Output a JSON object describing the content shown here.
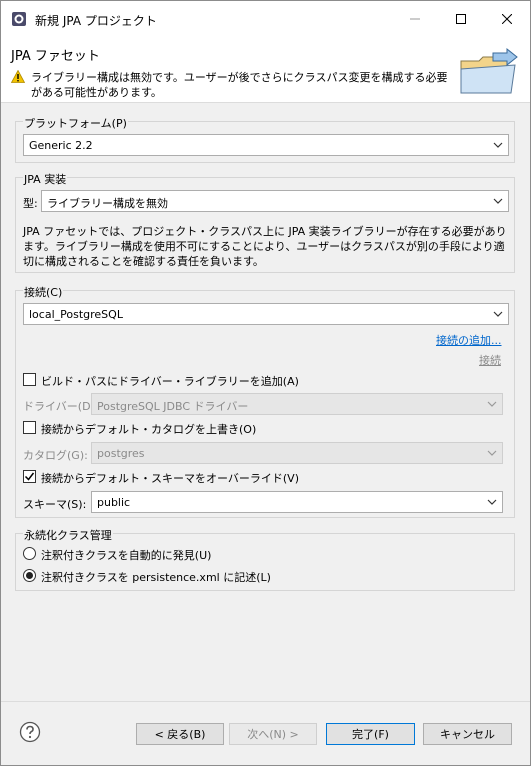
{
  "window": {
    "title": "新規 JPA プロジェクト"
  },
  "header": {
    "title": "JPA ファセット",
    "message": "ライブラリー構成は無効です。ユーザーが後でさらにクラスパス変更を構成する必要がある可能性があります。"
  },
  "platform": {
    "label": "プラットフォーム(P)",
    "value": "Generic 2.2"
  },
  "jpa_impl": {
    "label": "JPA 実装",
    "type_label": "型:",
    "type_value": "ライブラリー構成を無効",
    "description": "JPA ファセットでは、プロジェクト・クラスパス上に JPA 実装ライブラリーが存在する必要があります。ライブラリー構成を使用不可にすることにより、ユーザーはクラスパスが別の手段により適切に構成されることを確認する責任を負います。"
  },
  "connection": {
    "label": "接続(C)",
    "value": "local_PostgreSQL",
    "add_link": "接続の追加...",
    "connect_link": "接続",
    "add_driver_checkbox": "ビルド・パスにドライバー・ライブラリーを追加(A)",
    "add_driver_checked": false,
    "driver_label": "ドライバー(D):",
    "driver_value": "PostgreSQL JDBC ドライバー",
    "override_catalog_checkbox": "接続からデフォルト・カタログを上書き(O)",
    "override_catalog_checked": false,
    "catalog_label": "カタログ(G):",
    "catalog_value": "postgres",
    "override_schema_checkbox": "接続からデフォルト・スキーマをオーバーライド(V)",
    "override_schema_checked": true,
    "schema_label": "スキーマ(S):",
    "schema_value": "public"
  },
  "persistence": {
    "label": "永続化クラス管理",
    "option_auto": "注釈付きクラスを自動的に発見(U)",
    "option_xml": "注釈付きクラスを persistence.xml に記述(L)",
    "selected": "option_xml"
  },
  "buttons": {
    "back": "< 戻る(B)",
    "next": "次へ(N) >",
    "finish": "完了(F)",
    "cancel": "キャンセル"
  },
  "colors": {
    "link": "#0066cc",
    "primary_border": "#0078d7",
    "warning": "#f2c200"
  }
}
